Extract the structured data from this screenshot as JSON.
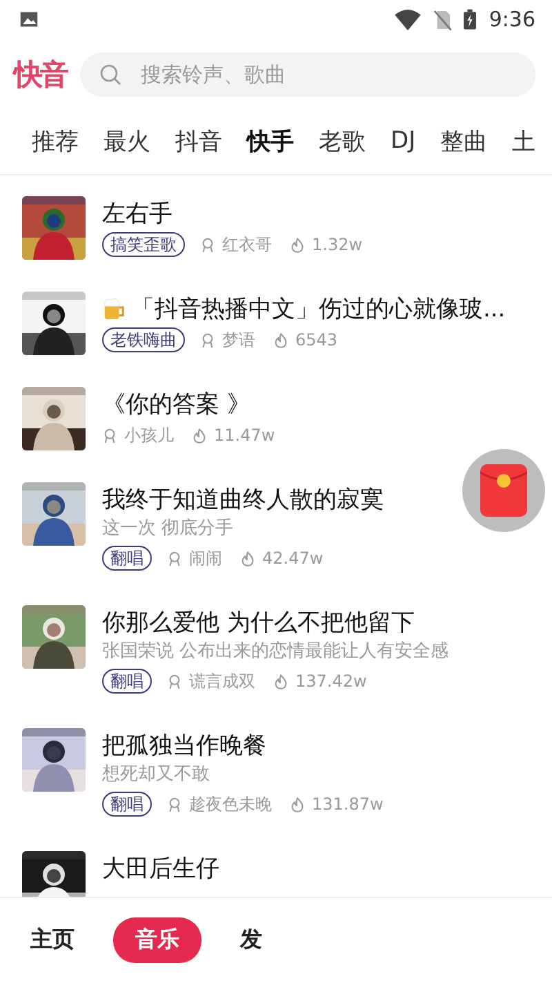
{
  "status_bar": {
    "time": "9:36"
  },
  "header": {
    "logo": "快音",
    "search": {
      "placeholder": "搜索铃声、歌曲"
    }
  },
  "tabs": [
    {
      "label": "推荐",
      "selected": false
    },
    {
      "label": "最火",
      "selected": false
    },
    {
      "label": "抖音",
      "selected": false
    },
    {
      "label": "快手",
      "selected": true
    },
    {
      "label": "老歌",
      "selected": false
    },
    {
      "label": "DJ",
      "selected": false
    },
    {
      "label": "整曲",
      "selected": false
    },
    {
      "label": "土",
      "selected": false
    }
  ],
  "songs": [
    {
      "title": "左右手",
      "tag": "搞笑歪歌",
      "author": "红衣哥",
      "plays": "1.32w"
    },
    {
      "title": "「抖音热播中文」伤过的心就像玻...",
      "kind": "emoji",
      "tag": "老铁嗨曲",
      "author": "梦语",
      "plays": "6543"
    },
    {
      "title": "《你的答案 》",
      "author": "小孩儿",
      "plays": "11.47w"
    },
    {
      "title": "我终于知道曲终人散的寂寞",
      "subtitle": "这一次 彻底分手",
      "tag": "翻唱",
      "author": "闹闹",
      "plays": "42.47w"
    },
    {
      "title": "你那么爱他 为什么不把他留下",
      "subtitle": "张国荣说 公布出来的恋情最能让人有安全感",
      "tag": "翻唱",
      "author": "谎言成双",
      "plays": "137.42w"
    },
    {
      "title": "把孤独当作晚餐",
      "subtitle": "想死却又不敢",
      "tag": "翻唱",
      "author": "趁夜色未晚",
      "plays": "131.87w"
    },
    {
      "title": "大田后生仔"
    }
  ],
  "bottom_nav": [
    {
      "label": "主页",
      "selected": false
    },
    {
      "label": "音乐",
      "selected": true
    },
    {
      "label": "发",
      "selected": false
    }
  ]
}
